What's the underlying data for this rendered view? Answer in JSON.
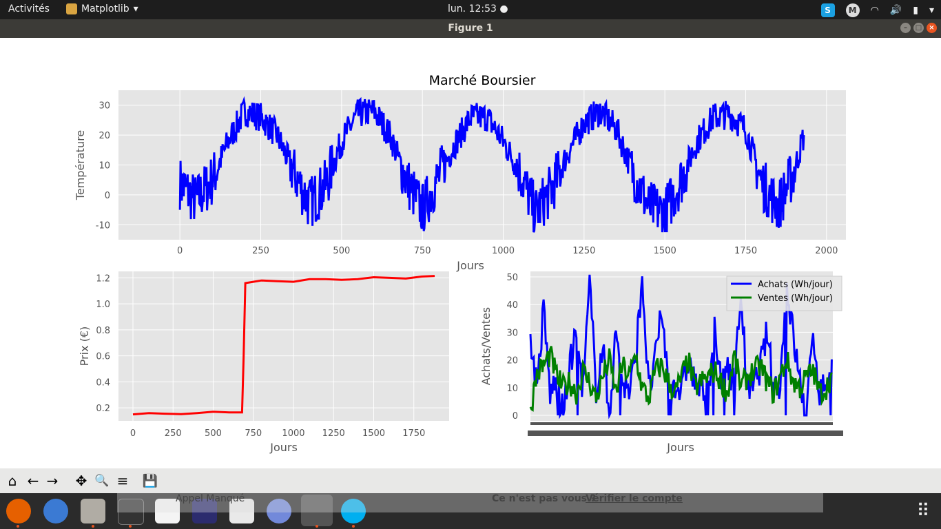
{
  "topbar": {
    "activities": "Activités",
    "app_name": "Matplotlib",
    "clock": "lun. 12:53",
    "skype_badge": "S",
    "user_badge": "M"
  },
  "window": {
    "title": "Figure 1"
  },
  "notification": {
    "left_text": "Appel Manqué",
    "right_text": "Ce n'est pas vous ?",
    "link_text": "Vérifier le compte"
  },
  "toolbar": {
    "home": "⌂",
    "back": "←",
    "forward": "→",
    "pan": "✥",
    "zoom": "🔍",
    "configure": "≡",
    "save": "💾"
  },
  "chart_data": [
    {
      "type": "line",
      "title": "Marché Boursier",
      "xlabel": "Jours",
      "ylabel": "Température",
      "xlim": [
        -190,
        2060
      ],
      "ylim": [
        -15,
        35
      ],
      "xticks": [
        0,
        250,
        500,
        750,
        1000,
        1250,
        1500,
        1750,
        2000
      ],
      "yticks": [
        -10,
        0,
        10,
        20,
        30
      ],
      "series": [
        {
          "color": "#0000ff",
          "description": "daily temperature, seasonal oscillation between about -12 and 33",
          "x": [
            0,
            50,
            100,
            150,
            200,
            250,
            300,
            350,
            400,
            450,
            500,
            550,
            600,
            650,
            700,
            750,
            800,
            850,
            900,
            950,
            1000,
            1050,
            1100,
            1150,
            1200,
            1250,
            1300,
            1350,
            1400,
            1450,
            1500,
            1550,
            1600,
            1650,
            1700,
            1750,
            1800,
            1850,
            1900,
            1930
          ],
          "y": [
            4,
            -2,
            5,
            18,
            28,
            26,
            20,
            8,
            -3,
            3,
            18,
            27,
            28,
            20,
            5,
            -5,
            6,
            17,
            26,
            26,
            18,
            8,
            -6,
            2,
            14,
            24,
            28,
            22,
            8,
            -4,
            -6,
            5,
            18,
            26,
            27,
            22,
            4,
            -4,
            8,
            20
          ]
        }
      ]
    },
    {
      "type": "line",
      "xlabel": "Jours",
      "ylabel": "Prix (€)",
      "xlim": [
        -90,
        1970
      ],
      "ylim": [
        0.1,
        1.25
      ],
      "xticks": [
        0,
        250,
        500,
        750,
        1000,
        1250,
        1500,
        1750
      ],
      "yticks": [
        0.2,
        0.4,
        0.6,
        0.8,
        1.0,
        1.2
      ],
      "series": [
        {
          "color": "#ff0000",
          "x": [
            0,
            100,
            200,
            300,
            400,
            500,
            600,
            680,
            690,
            700,
            750,
            800,
            900,
            1000,
            1100,
            1200,
            1300,
            1400,
            1500,
            1600,
            1700,
            1800,
            1880
          ],
          "y": [
            0.15,
            0.16,
            0.155,
            0.152,
            0.16,
            0.17,
            0.165,
            0.165,
            0.6,
            1.16,
            1.17,
            1.18,
            1.175,
            1.17,
            1.19,
            1.19,
            1.185,
            1.19,
            1.205,
            1.2,
            1.195,
            1.21,
            1.215
          ]
        }
      ]
    },
    {
      "type": "line",
      "xlabel": "Jours",
      "ylabel": "Achats/Ventes",
      "ylim": [
        -2,
        52
      ],
      "yticks": [
        0,
        10,
        20,
        30,
        40,
        50
      ],
      "legend_position": "top-right",
      "series": [
        {
          "name": "Achats (Wh/jour)",
          "color": "#0000ff",
          "description": "daily purchases, mostly between 5 and 30 with peaks up to 51",
          "values": [
            28,
            10,
            38,
            8,
            12,
            0,
            18,
            30,
            9,
            47,
            10,
            25,
            0,
            30,
            12,
            8,
            20,
            51,
            8,
            20,
            38,
            10,
            12,
            8,
            20,
            12,
            8,
            10,
            30,
            10,
            20,
            10,
            45,
            8,
            10,
            18,
            30,
            10,
            12,
            47,
            28,
            12,
            0,
            30,
            8,
            12,
            18
          ]
        },
        {
          "name": "Ventes (Wh/jour)",
          "color": "#008000",
          "description": "daily sales, mostly between 3 and 25",
          "values": [
            2,
            15,
            18,
            22,
            14,
            10,
            12,
            8,
            16,
            12,
            6,
            14,
            20,
            8,
            18,
            14,
            22,
            10,
            6,
            16,
            18,
            12,
            8,
            14,
            20,
            10,
            12,
            14,
            16,
            12,
            8,
            22,
            10,
            14,
            16,
            18,
            12,
            8,
            14,
            20,
            12,
            10,
            14,
            16,
            8,
            10,
            15
          ]
        }
      ]
    }
  ]
}
